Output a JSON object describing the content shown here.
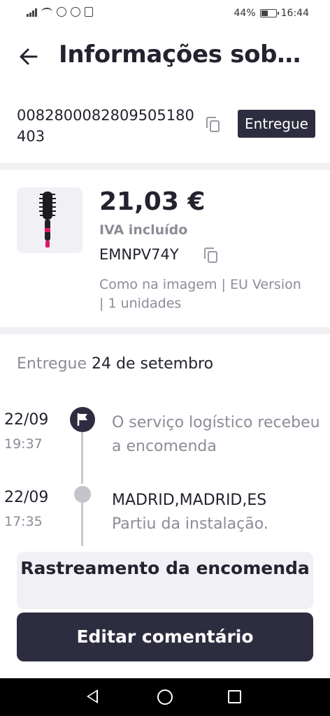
{
  "status_bar": {
    "battery": "44%",
    "time": "16:44"
  },
  "header": {
    "title": "Informações sobre…"
  },
  "order": {
    "id": "0082800082809505180403",
    "status": "Entregue"
  },
  "product": {
    "price": "21,03 €",
    "vat": "IVA incluído",
    "sku": "EMNPV74Y",
    "variant": "Como na imagem | EU Version | 1 unidades"
  },
  "delivery": {
    "label": "Entregue",
    "date": "24 de setembro"
  },
  "timeline": [
    {
      "date": "22/09",
      "time": "19:37",
      "location": "",
      "text": "O serviço logístico recebeu a encomenda"
    },
    {
      "date": "22/09",
      "time": "17:35",
      "location": "MADRID,MADRID,ES",
      "text": "Partiu da instalação."
    }
  ],
  "buttons": {
    "track": "Rastreamento da encomenda",
    "edit": "Editar comentário"
  },
  "colors": {
    "primary": "#2d2d3f",
    "muted": "#8c8c98",
    "accent": "#e0186c"
  }
}
